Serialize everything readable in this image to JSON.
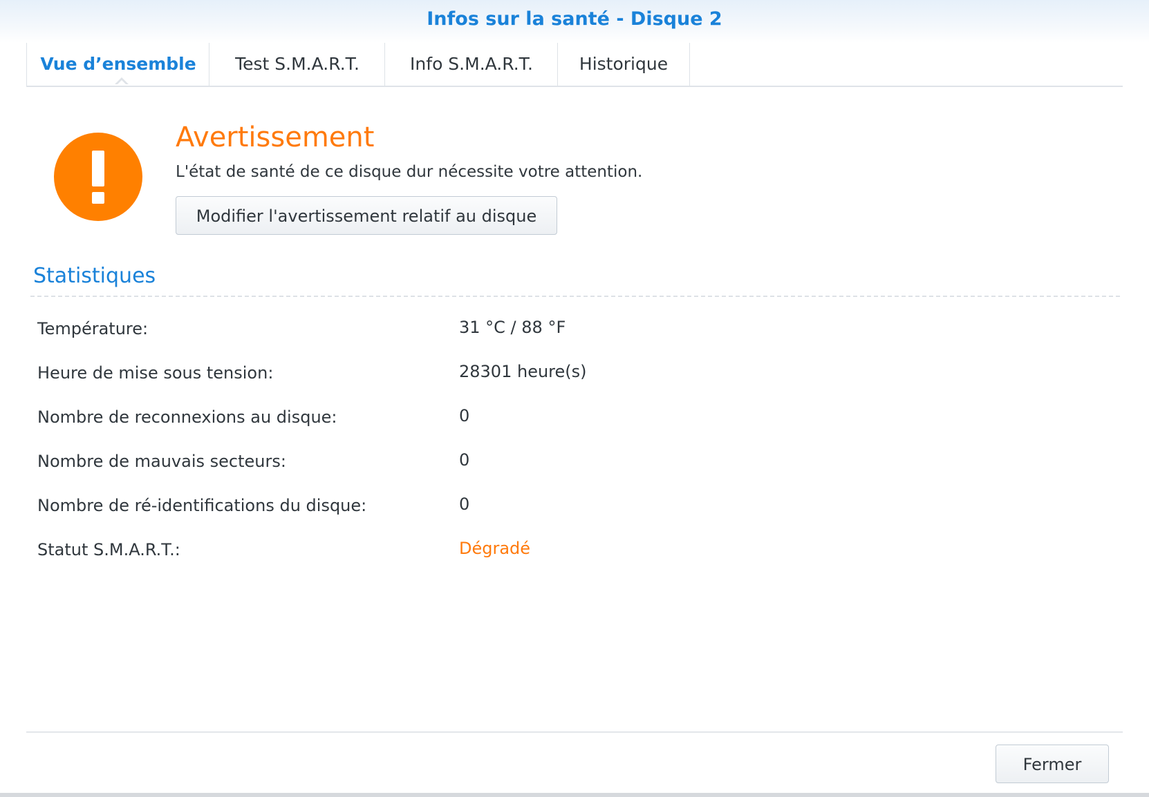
{
  "window": {
    "title": "Infos sur la santé - Disque 2"
  },
  "tabs": [
    {
      "label": "Vue d’ensemble",
      "active": true
    },
    {
      "label": "Test S.M.A.R.T.",
      "active": false
    },
    {
      "label": "Info S.M.A.R.T.",
      "active": false
    },
    {
      "label": "Historique",
      "active": false
    }
  ],
  "status": {
    "icon": "warning-exclamation-icon",
    "title": "Avertissement",
    "message": "L'état de santé de ce disque dur nécessite votre attention.",
    "modify_button": "Modifier l'avertissement relatif au disque"
  },
  "statistics": {
    "title": "Statistiques",
    "rows": [
      {
        "label": "Température:",
        "value": "31 °C / 88 °F"
      },
      {
        "label": "Heure de mise sous tension:",
        "value": "28301 heure(s)"
      },
      {
        "label": "Nombre de reconnexions au disque:",
        "value": "0"
      },
      {
        "label": "Nombre de mauvais secteurs:",
        "value": "0"
      },
      {
        "label": "Nombre de ré-identifications du disque:",
        "value": "0"
      },
      {
        "label": "Statut S.M.A.R.T.:",
        "value": "Dégradé"
      }
    ]
  },
  "footer": {
    "close_button": "Fermer"
  },
  "colors": {
    "accent": "#1a82d9",
    "warning": "#ff8000",
    "text": "#30373d"
  }
}
